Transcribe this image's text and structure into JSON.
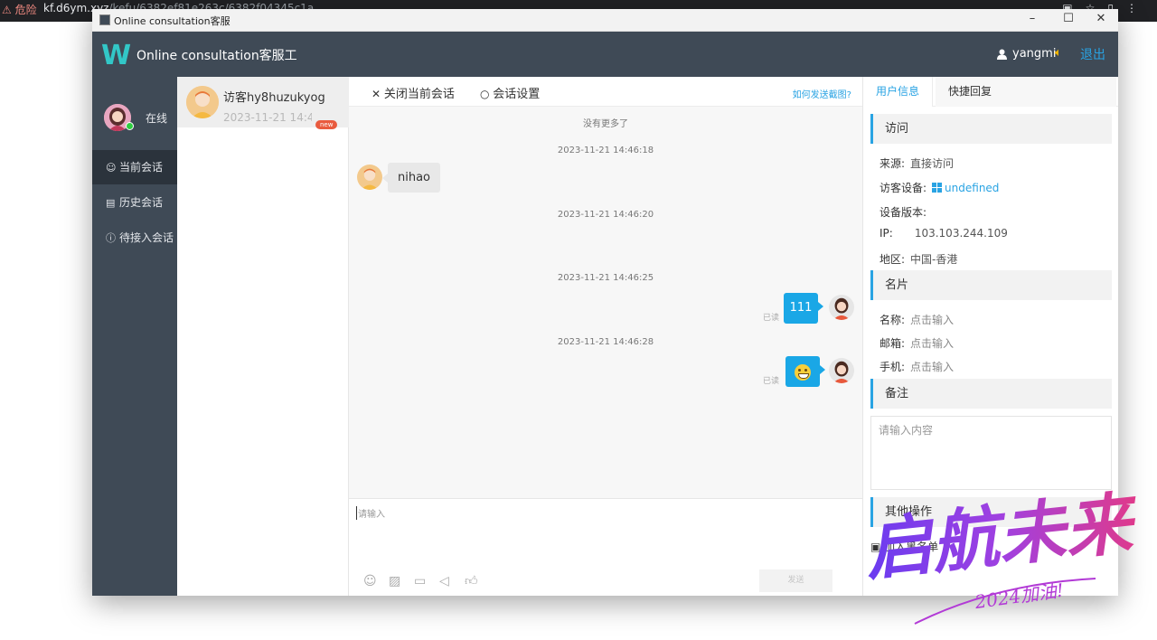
{
  "browser": {
    "warning": "⚠ 危险",
    "url_host": "kf.d6ym.xyz",
    "url_path": "/kefu/6382ef81e263c/6382f04345c1a"
  },
  "window": {
    "title": "Online consultation客服",
    "controls": [
      "–",
      "☐",
      "✕"
    ]
  },
  "header": {
    "logo": "W",
    "brand": "Online consultation客服工",
    "username": "yangmi",
    "logout": "退出"
  },
  "nav": {
    "status": "在线",
    "items": [
      {
        "label": "当前会话",
        "icon": "☺"
      },
      {
        "label": "历史会话",
        "icon": "▤"
      },
      {
        "label": "待接入会话",
        "icon": "ⓘ"
      }
    ]
  },
  "visitors": [
    {
      "name": "访客hy8huzukyog",
      "time": "2023-11-21 14:46",
      "badge": "new"
    }
  ],
  "chat": {
    "close_label": "关闭当前会话",
    "settings_label": "会话设置",
    "help_link": "如何发送截图?",
    "no_more": "没有更多了",
    "timestamps": [
      "2023-11-21 14:46:18",
      "2023-11-21 14:46:20",
      "2023-11-21 14:46:25",
      "2023-11-21 14:46:28"
    ],
    "incoming_text": "nihao",
    "outgoing_text": "111",
    "read_label": "已读",
    "input_placeholder": "请输入",
    "send_label": "发送"
  },
  "info": {
    "tabs": [
      "用户信息",
      "快捷回复"
    ],
    "visit_title": "访问",
    "source_label": "来源:",
    "source_value": "直接访问",
    "device_label": "访客设备:",
    "device_value": "undefined",
    "version_label": "设备版本:",
    "ip_label": "IP:",
    "ip_value": "103.103.244.109",
    "region_label": "地区:",
    "region_value": "中国-香港",
    "card_title": "名片",
    "name_label": "名称:",
    "email_label": "邮箱:",
    "phone_label": "手机:",
    "click_input": "点击输入",
    "note_title": "备注",
    "note_placeholder": "请输入内容",
    "other_title": "其他操作",
    "blacklist": "加入黑名单"
  },
  "watermark": {
    "main": "启航未来",
    "sub": "2024加油!"
  },
  "colors": {
    "accent": "#29a3e3",
    "sidebar": "#3f4a56",
    "bubble": "#1aa7e6"
  }
}
